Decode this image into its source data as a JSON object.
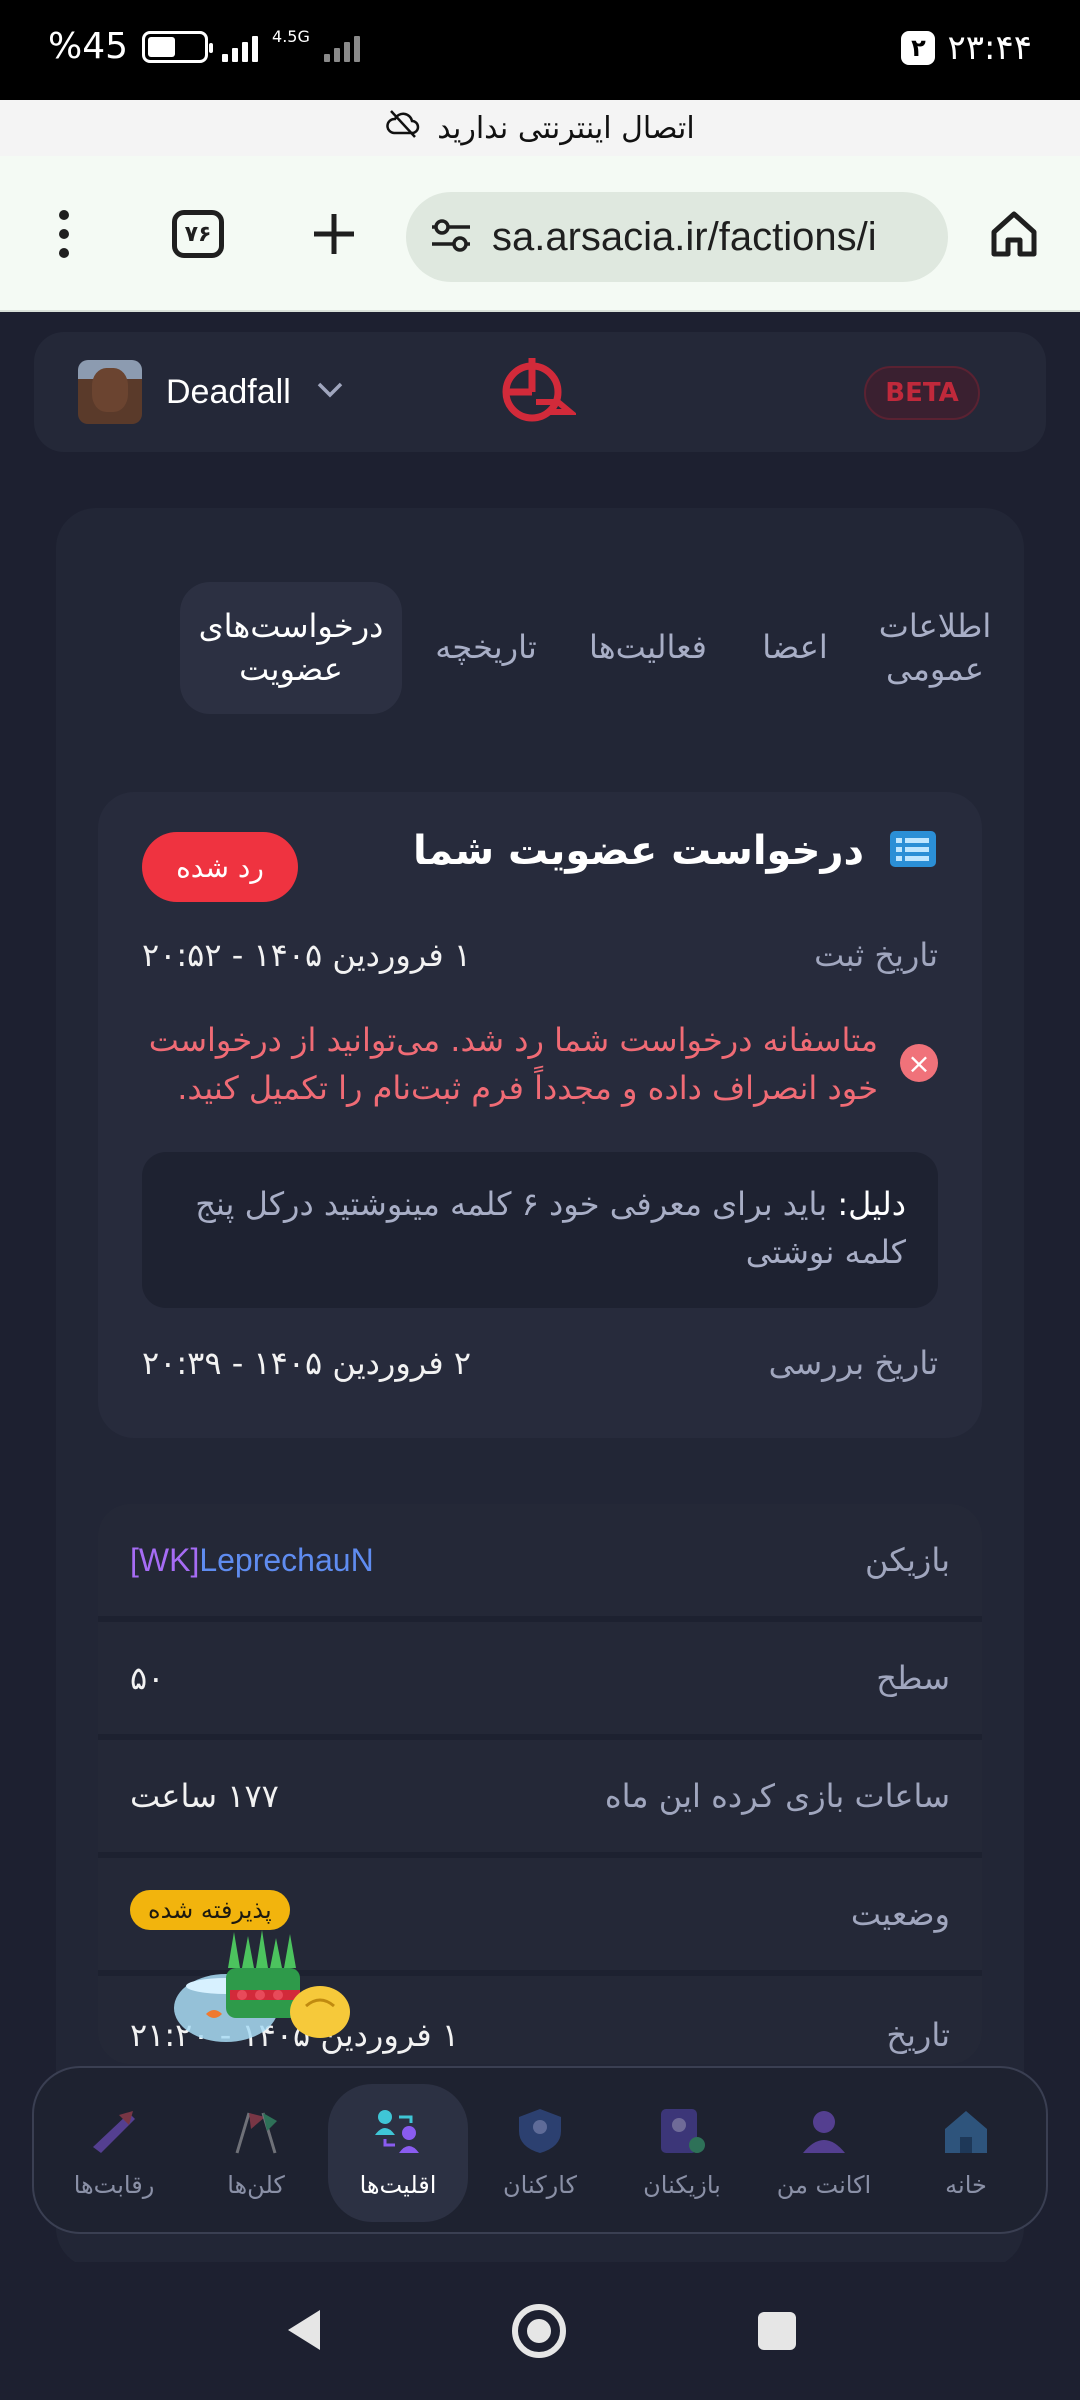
{
  "status_bar": {
    "battery_text": "%45",
    "battery_level": 0.45,
    "network_label": "4.5G",
    "notification_count": "۲",
    "time": "۲۳:۴۴",
    "offline_message": "اتصال اینترنتی ندارید"
  },
  "browser": {
    "url": "sa.arsacia.ir/factions/i",
    "tabs_count": "۷۶"
  },
  "header": {
    "username": "Deadfall",
    "beta_label": "BETA"
  },
  "tabs": [
    {
      "label": "اطلاعات عمومی"
    },
    {
      "label": "اعضا"
    },
    {
      "label": "فعالیت‌ها"
    },
    {
      "label": "تاریخچه"
    },
    {
      "label": "درخواست‌های عضویت"
    }
  ],
  "membership": {
    "title": "درخواست عضویت شما",
    "status": "رد شده",
    "submit_date_label": "تاریخ ثبت",
    "submit_date_value": "۱ فروردین ۱۴۰۵ - ۲۰:۵۲",
    "error_message": "متاسفانه درخواست شما رد شد. می‌توانید از درخواست خود انصراف داده و مجدداً فرم ثبت‌نام را تکمیل کنید.",
    "reason_label": "دلیل:",
    "reason_text": "باید برای معرفی خود ۶ کلمه مینوشتید درکل پنج کلمه نوشتی",
    "review_date_label": "تاریخ بررسی",
    "review_date_value": "۲ فروردین ۱۴۰۵ - ۲۰:۳۹"
  },
  "info": {
    "player_label": "بازیکن",
    "player_tag": "[WK]",
    "player_name": "LeprechauN",
    "level_label": "سطح",
    "level_value": "۵۰",
    "hours_label": "ساعات بازی کرده این ماه",
    "hours_value": "۱۷۷ ساعت",
    "status_label": "وضعیت",
    "status_value": "پذیرفته شده",
    "date_label": "تاریخ",
    "date_value": "۱ فروردین ۱۴۰۵ - ۲۱:۲۰"
  },
  "bottom_nav": [
    {
      "label": "خانه",
      "icon": "home-icon"
    },
    {
      "label": "اکانت من",
      "icon": "account-icon"
    },
    {
      "label": "بازیکنان",
      "icon": "players-icon"
    },
    {
      "label": "کارکنان",
      "icon": "staff-icon"
    },
    {
      "label": "اقلیت‌ها",
      "icon": "factions-icon"
    },
    {
      "label": "کلن‌ها",
      "icon": "clans-icon"
    },
    {
      "label": "رقابت‌ها",
      "icon": "competitions-icon"
    }
  ],
  "colors": {
    "accent_red": "#ef3340",
    "accepted_yellow": "#f2b40d",
    "error_text": "#f06b75",
    "player_tag": "#a66cf5",
    "player_name": "#5f8cf0"
  }
}
